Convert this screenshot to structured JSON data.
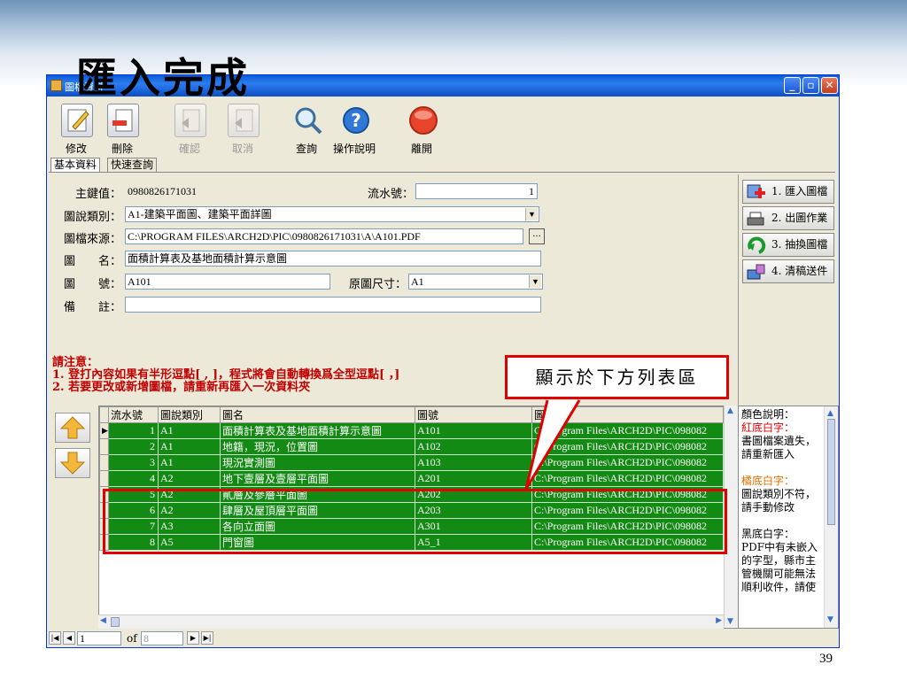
{
  "slide": {
    "title": "匯入完成",
    "page_number": "39"
  },
  "window": {
    "title": "圖檔資料",
    "controls": {
      "minimize": "_",
      "restore": "▫",
      "close": "✕"
    }
  },
  "toolbar": {
    "buttons": [
      {
        "label": "修改",
        "enabled": true
      },
      {
        "label": "刪除",
        "enabled": true
      },
      {
        "label": "確認",
        "enabled": false
      },
      {
        "label": "取消",
        "enabled": false
      },
      {
        "label": "查詢",
        "enabled": true
      },
      {
        "label": "操作說明",
        "enabled": true
      },
      {
        "label": "離開",
        "enabled": true
      }
    ]
  },
  "tabs": [
    {
      "label": "基本資料",
      "active": true
    },
    {
      "label": "快速查詢",
      "active": false
    }
  ],
  "form": {
    "key_label": "主鍵值：",
    "key_value": "0980826171031",
    "serial_label": "流水號：",
    "serial_value": "1",
    "category_label": "圖說類別：",
    "category_value": "A1-建築平面圖、建築平面詳圖",
    "source_label": "圖檔來源：",
    "source_value": "C:\\PROGRAM FILES\\ARCH2D\\PIC\\0980826171031\\A\\A101.PDF",
    "browse_label": "...",
    "name_label": "圖　　名：",
    "name_value": "面積計算表及基地面積計算示意圖",
    "number_label": "圖　　號：",
    "number_value": "A101",
    "size_label": "原圖尺寸：",
    "size_value": "A1",
    "note_label": "備　　註：",
    "note_value": ""
  },
  "notice": {
    "line1": "請注意：",
    "line2": "1. 登打內容如果有半形逗點[ , ]，程式將會自動轉換爲全型逗點[ ，]",
    "line3": "2. 若要更改或新增圖檔，請重新再匯入一次資料夾"
  },
  "side_actions": [
    "1. 匯入圖檔",
    "2. 出圖作業",
    "3. 抽換圖檔",
    "4. 清稿送件"
  ],
  "grid": {
    "columns": [
      "流水號",
      "圖說類別",
      "圖名",
      "圖號",
      "圖"
    ],
    "rows": [
      {
        "serial": "1",
        "category": "A1",
        "name": "面積計算表及基地面積計算示意圖",
        "number": "A101",
        "path": "C:\\Program Files\\ARCH2D\\PIC\\098082"
      },
      {
        "serial": "2",
        "category": "A1",
        "name": "地籍，現況，位置圖",
        "number": "A102",
        "path": "C:\\Program Files\\ARCH2D\\PIC\\098082"
      },
      {
        "serial": "3",
        "category": "A1",
        "name": "現況實測圖",
        "number": "A103",
        "path": "C:\\Program Files\\ARCH2D\\PIC\\098082"
      },
      {
        "serial": "4",
        "category": "A2",
        "name": "地下壹層及壹層平面圖",
        "number": "A201",
        "path": "C:\\Program Files\\ARCH2D\\PIC\\098082"
      },
      {
        "serial": "5",
        "category": "A2",
        "name": "貳層及參層平面圖",
        "number": "A202",
        "path": "C:\\Program Files\\ARCH2D\\PIC\\098082"
      },
      {
        "serial": "6",
        "category": "A2",
        "name": "肆層及屋頂層平面圖",
        "number": "A203",
        "path": "C:\\Program Files\\ARCH2D\\PIC\\098082"
      },
      {
        "serial": "7",
        "category": "A3",
        "name": "各向立面圖",
        "number": "A301",
        "path": "C:\\Program Files\\ARCH2D\\PIC\\098082"
      },
      {
        "serial": "8",
        "category": "A5",
        "name": "門窗圖",
        "number": "A5_1",
        "path": "C:\\Program Files\\ARCH2D\\PIC\\098082"
      }
    ]
  },
  "legend": {
    "title": "顏色說明：",
    "red_head": "紅底白字：",
    "red_text": "書圖檔案遺失，請重新匯入",
    "orange_head": "橘底白字：",
    "orange_text": "圖說類別不符，請手動修改",
    "black_head": "黑底白字：",
    "black_text": "PDF中有未嵌入的字型，縣市主管機關可能無法順利收件，請使"
  },
  "pager": {
    "current": "1",
    "of_label": "of",
    "total": "8"
  },
  "callout": {
    "text": "顯示於下方列表區"
  },
  "colors": {
    "row_green": "#138a13",
    "notice_red": "#c00000",
    "highlight_red": "#e00000"
  }
}
